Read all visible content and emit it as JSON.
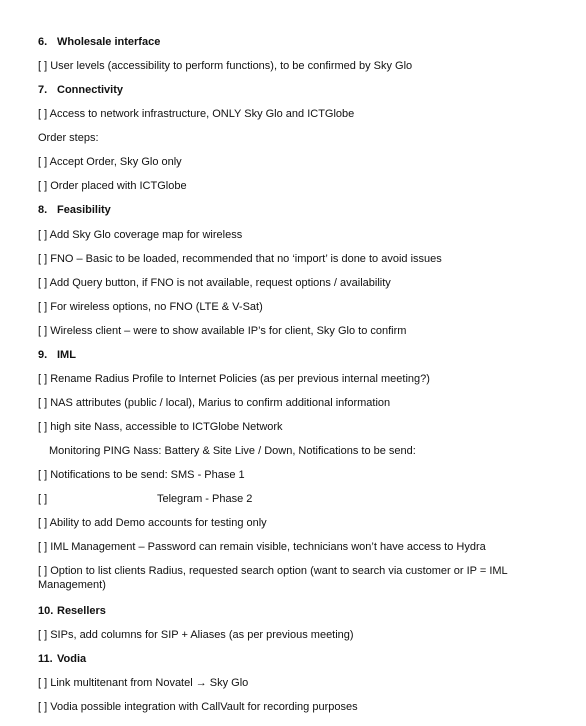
{
  "sections": [
    {
      "number": "6.",
      "title": "Wholesale interface",
      "items": [
        "[ ] User levels (accessibility to perform functions), to be confirmed by Sky Glo"
      ]
    },
    {
      "number": "7.",
      "title": "Connectivity",
      "items": [
        "[ ] Access to network infrastructure, ONLY Sky Glo and ICTGlobe",
        "Order steps:",
        "[ ] Accept Order, Sky Glo only",
        "[ ] Order placed with ICTGlobe"
      ]
    },
    {
      "number": "8.",
      "title": "Feasibility",
      "items": [
        "[ ] Add Sky Glo coverage map for wireless",
        "[ ] FNO – Basic to be loaded, recommended that no ‘import’ is done to avoid issues",
        "[ ] Add Query button, if FNO is not available, request options / availability",
        "[ ] For wireless options, no FNO (LTE & V-Sat)",
        "[ ] Wireless client – were to show available IP’s for client, Sky Glo to confirm"
      ]
    },
    {
      "number": "9.",
      "title": "IML",
      "items": [
        "[ ] Rename Radius Profile to Internet Policies (as per previous internal meeting?)",
        "[ ] NAS attributes (public / local), Marius to confirm additional information",
        "[ ] high site Nass, accessible to ICTGlobe Network",
        "Monitoring PING Nass: Battery & Site Live / Down, Notifications to be send:",
        "[ ] Notifications to be send: SMS -   Phase 1",
        "[ ]                                    Telegram - Phase 2",
        "[ ] Ability to add Demo accounts for testing only",
        "[ ] IML Management – Password can remain visible, technicians won’t have access to Hydra",
        "[ ] Option to list clients Radius, requested search option (want to search via customer or IP = IML Management)"
      ]
    },
    {
      "number": "10.",
      "title": "Resellers",
      "items": [
        "[ ] SIPs, add columns for SIP + Aliases (as per previous meeting)"
      ]
    },
    {
      "number": "11.",
      "title": "Vodia",
      "items": [
        "[ ] Link multitenant from Novatel → Sky Glo",
        "[ ] Vodia possible integration with CallVault for recording purposes"
      ]
    }
  ]
}
